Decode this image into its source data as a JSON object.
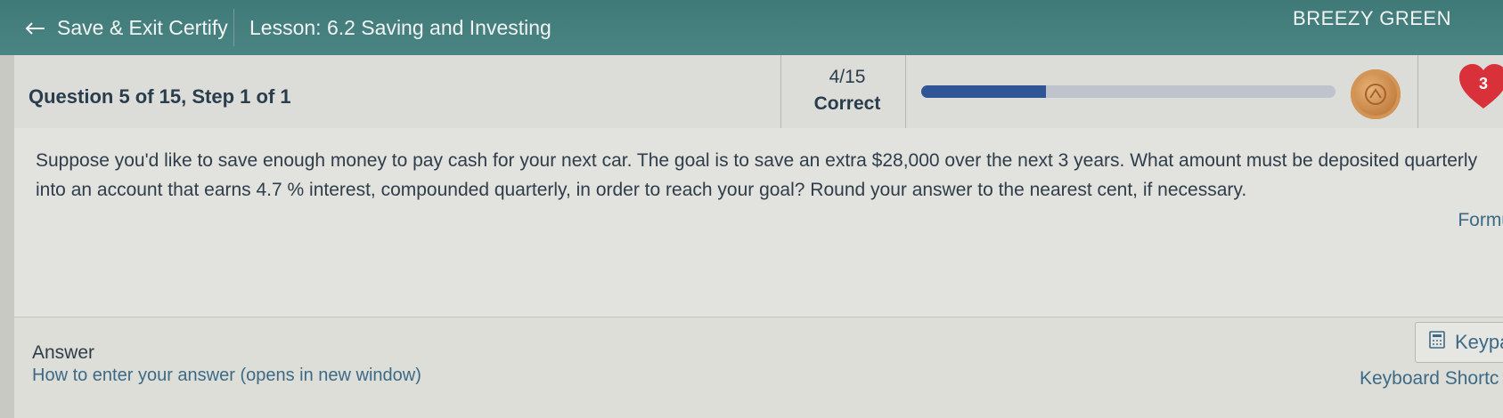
{
  "header": {
    "back_label": "Save & Exit Certify",
    "lesson_title": "Lesson: 6.2 Saving and Investing",
    "user_name": "BREEZY GREEN"
  },
  "status": {
    "question_label": "Question 5 of 15, Step 1 of 1",
    "score": "4/15",
    "score_label": "Correct",
    "progress_fraction": 0.3,
    "lives": "3"
  },
  "question": {
    "text": "Suppose you'd like to save enough money to pay cash for your next car. The goal is to save an extra $28,000 over the next 3 years. What amount must be deposited quarterly into an account that earns 4.7 %  interest, compounded quarterly, in order to reach your goal? Round your answer to the nearest cent, if necessary.",
    "formula_link": "Formu"
  },
  "answer": {
    "title": "Answer",
    "help_link": "How to enter your answer (opens in new window)",
    "keypad_label": "Keypa",
    "shortcuts_label": "Keyboard Shortc"
  },
  "colors": {
    "header_bg": "#437e7d",
    "progress_fill": "#2f5596",
    "heart": "#d9313a",
    "coin": "#c9864a",
    "link": "#3c6a86"
  },
  "icons": {
    "back": "arrow-left-icon",
    "coin": "coin-icon",
    "heart": "heart-icon",
    "keypad": "calculator-icon"
  }
}
